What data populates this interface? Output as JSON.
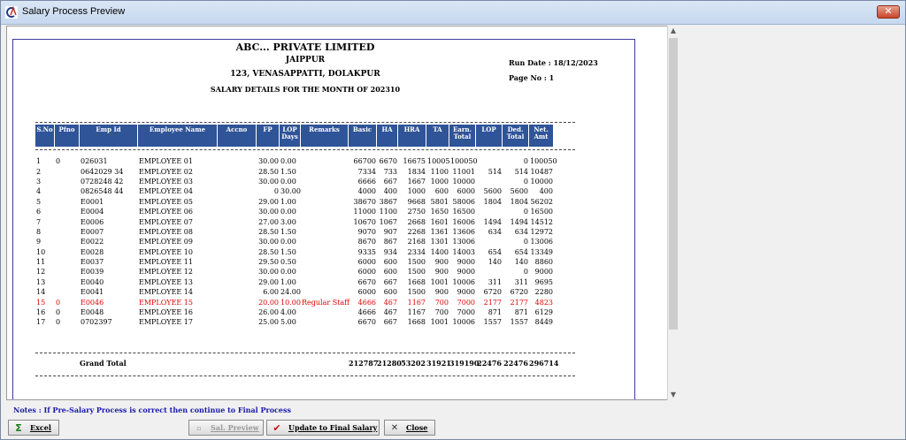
{
  "window": {
    "title": "Salary Process Preview",
    "close_glyph": "✕"
  },
  "report": {
    "company": "ABC... PRIVATE LIMITED",
    "city": "JAIPPUR",
    "address": "123, VENASAPPATTI, DOLAKPUR",
    "subtitle": "SALARY DETAILS FOR THE MONTH OF 202310",
    "run_date": "Run Date : 18/12/2023",
    "page_no": "Page No : 1"
  },
  "columns": [
    "S.No",
    "Pfno",
    "Emp Id",
    "Employee Name",
    "Accno",
    "FP",
    "LOP Days",
    "Remarks",
    "Basic",
    "HA",
    "HRA",
    "TA",
    "Earn. Total",
    "LOP",
    "Ded. Total",
    "Net. Amt"
  ],
  "rows": [
    [
      "1",
      "0",
      "026031",
      "EMPLOYEE 01",
      "",
      "30.00",
      "0.00",
      "",
      "66700",
      "6670",
      "16675",
      "10005",
      "100050",
      "",
      "0",
      "100050"
    ],
    [
      "2",
      "",
      "0642029  34",
      "EMPLOYEE 02",
      "",
      "28.50",
      "1.50",
      "",
      "7334",
      "733",
      "1834",
      "1100",
      "11001",
      "514",
      "514",
      "10487"
    ],
    [
      "3",
      "",
      "0728248  42",
      "EMPLOYEE 03",
      "",
      "30.00",
      "0.00",
      "",
      "6666",
      "667",
      "1667",
      "1000",
      "10000",
      "",
      "0",
      "10000"
    ],
    [
      "4",
      "",
      "0826548  44",
      "EMPLOYEE 04",
      "",
      "0",
      "30.00",
      "",
      "4000",
      "400",
      "1000",
      "600",
      "6000",
      "5600",
      "5600",
      "400"
    ],
    [
      "5",
      "",
      "E0001",
      "EMPLOYEE 05",
      "",
      "29.00",
      "1.00",
      "",
      "38670",
      "3867",
      "9668",
      "5801",
      "58006",
      "1804",
      "1804",
      "56202"
    ],
    [
      "6",
      "",
      "E0004",
      "EMPLOYEE 06",
      "",
      "30.00",
      "0.00",
      "",
      "11000",
      "1100",
      "2750",
      "1650",
      "16500",
      "",
      "0",
      "16500"
    ],
    [
      "7",
      "",
      "E0006",
      "EMPLOYEE 07",
      "",
      "27.00",
      "3.00",
      "",
      "10670",
      "1067",
      "2668",
      "1601",
      "16006",
      "1494",
      "1494",
      "14512"
    ],
    [
      "8",
      "",
      "E0007",
      "EMPLOYEE 08",
      "",
      "28.50",
      "1.50",
      "",
      "9070",
      "907",
      "2268",
      "1361",
      "13606",
      "634",
      "634",
      "12972"
    ],
    [
      "9",
      "",
      "E0022",
      "EMPLOYEE 09",
      "",
      "30.00",
      "0.00",
      "",
      "8670",
      "867",
      "2168",
      "1301",
      "13006",
      "",
      "0",
      "13006"
    ],
    [
      "10",
      "",
      "E0028",
      "EMPLOYEE 10",
      "",
      "28.50",
      "1.50",
      "",
      "9335",
      "934",
      "2334",
      "1400",
      "14003",
      "654",
      "654",
      "13349"
    ],
    [
      "11",
      "",
      "E0037",
      "EMPLOYEE 11",
      "",
      "29.50",
      "0.50",
      "",
      "6000",
      "600",
      "1500",
      "900",
      "9000",
      "140",
      "140",
      "8860"
    ],
    [
      "12",
      "",
      "E0039",
      "EMPLOYEE 12",
      "",
      "30.00",
      "0.00",
      "",
      "6000",
      "600",
      "1500",
      "900",
      "9000",
      "",
      "0",
      "9000"
    ],
    [
      "13",
      "",
      "E0040",
      "EMPLOYEE 13",
      "",
      "29.00",
      "1.00",
      "",
      "6670",
      "667",
      "1668",
      "1001",
      "10006",
      "311",
      "311",
      "9695"
    ],
    [
      "14",
      "",
      "E0041",
      "EMPLOYEE 14",
      "",
      "6.00",
      "24.00",
      "",
      "6000",
      "600",
      "1500",
      "900",
      "9000",
      "6720",
      "6720",
      "2280"
    ],
    [
      "15",
      "0",
      "E0046",
      "EMPLOYEE 15",
      "",
      "20.00",
      "10.00",
      "Regular Staff",
      "4666",
      "467",
      "1167",
      "700",
      "7000",
      "2177",
      "2177",
      "4823"
    ],
    [
      "16",
      "0",
      "E0048",
      "EMPLOYEE 16",
      "",
      "26.00",
      "4.00",
      "",
      "4666",
      "467",
      "1167",
      "700",
      "7000",
      "871",
      "871",
      "6129"
    ],
    [
      "17",
      "0",
      "0702397",
      "EMPLOYEE 17",
      "",
      "25.00",
      "5.00",
      "",
      "6670",
      "667",
      "1668",
      "1001",
      "10006",
      "1557",
      "1557",
      "8449"
    ]
  ],
  "highlight_row": 14,
  "highlight_color": "#e00000",
  "grand_total": {
    "label": "Grand Total",
    "basic": "212787",
    "ha": "21280",
    "hra": "53202",
    "ta": "31921",
    "earn": "319190",
    "lop": "22476",
    "ded": "22476",
    "net": "296714"
  },
  "notes": "Notes :  If Pre-Salary Process is correct then  continue to Final Process",
  "buttons": {
    "excel": "Excel",
    "preview": "Sal. Preview",
    "update": "Update to Final Salary",
    "close": "Close"
  }
}
